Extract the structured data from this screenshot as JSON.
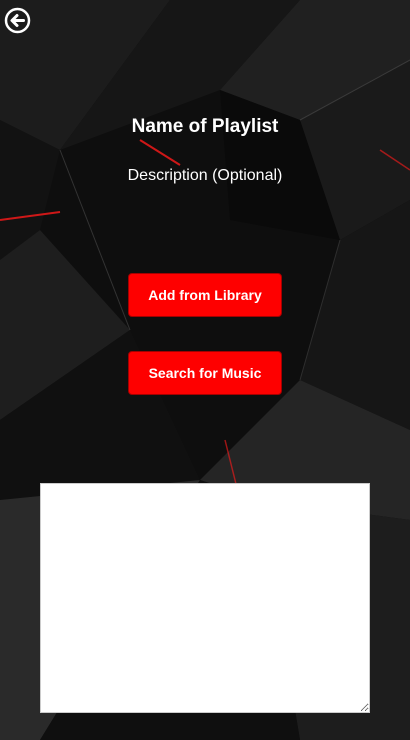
{
  "header": {
    "back_icon": "back-arrow-circle-icon"
  },
  "playlist": {
    "name": "Name of Playlist",
    "description": "Description (Optional)"
  },
  "actions": {
    "add_from_library_label": "Add from Library",
    "search_for_music_label": "Search for Music"
  },
  "results": {
    "value": ""
  },
  "colors": {
    "accent": "#fe0000",
    "background": "#0d0d0d",
    "text": "#ffffff"
  }
}
